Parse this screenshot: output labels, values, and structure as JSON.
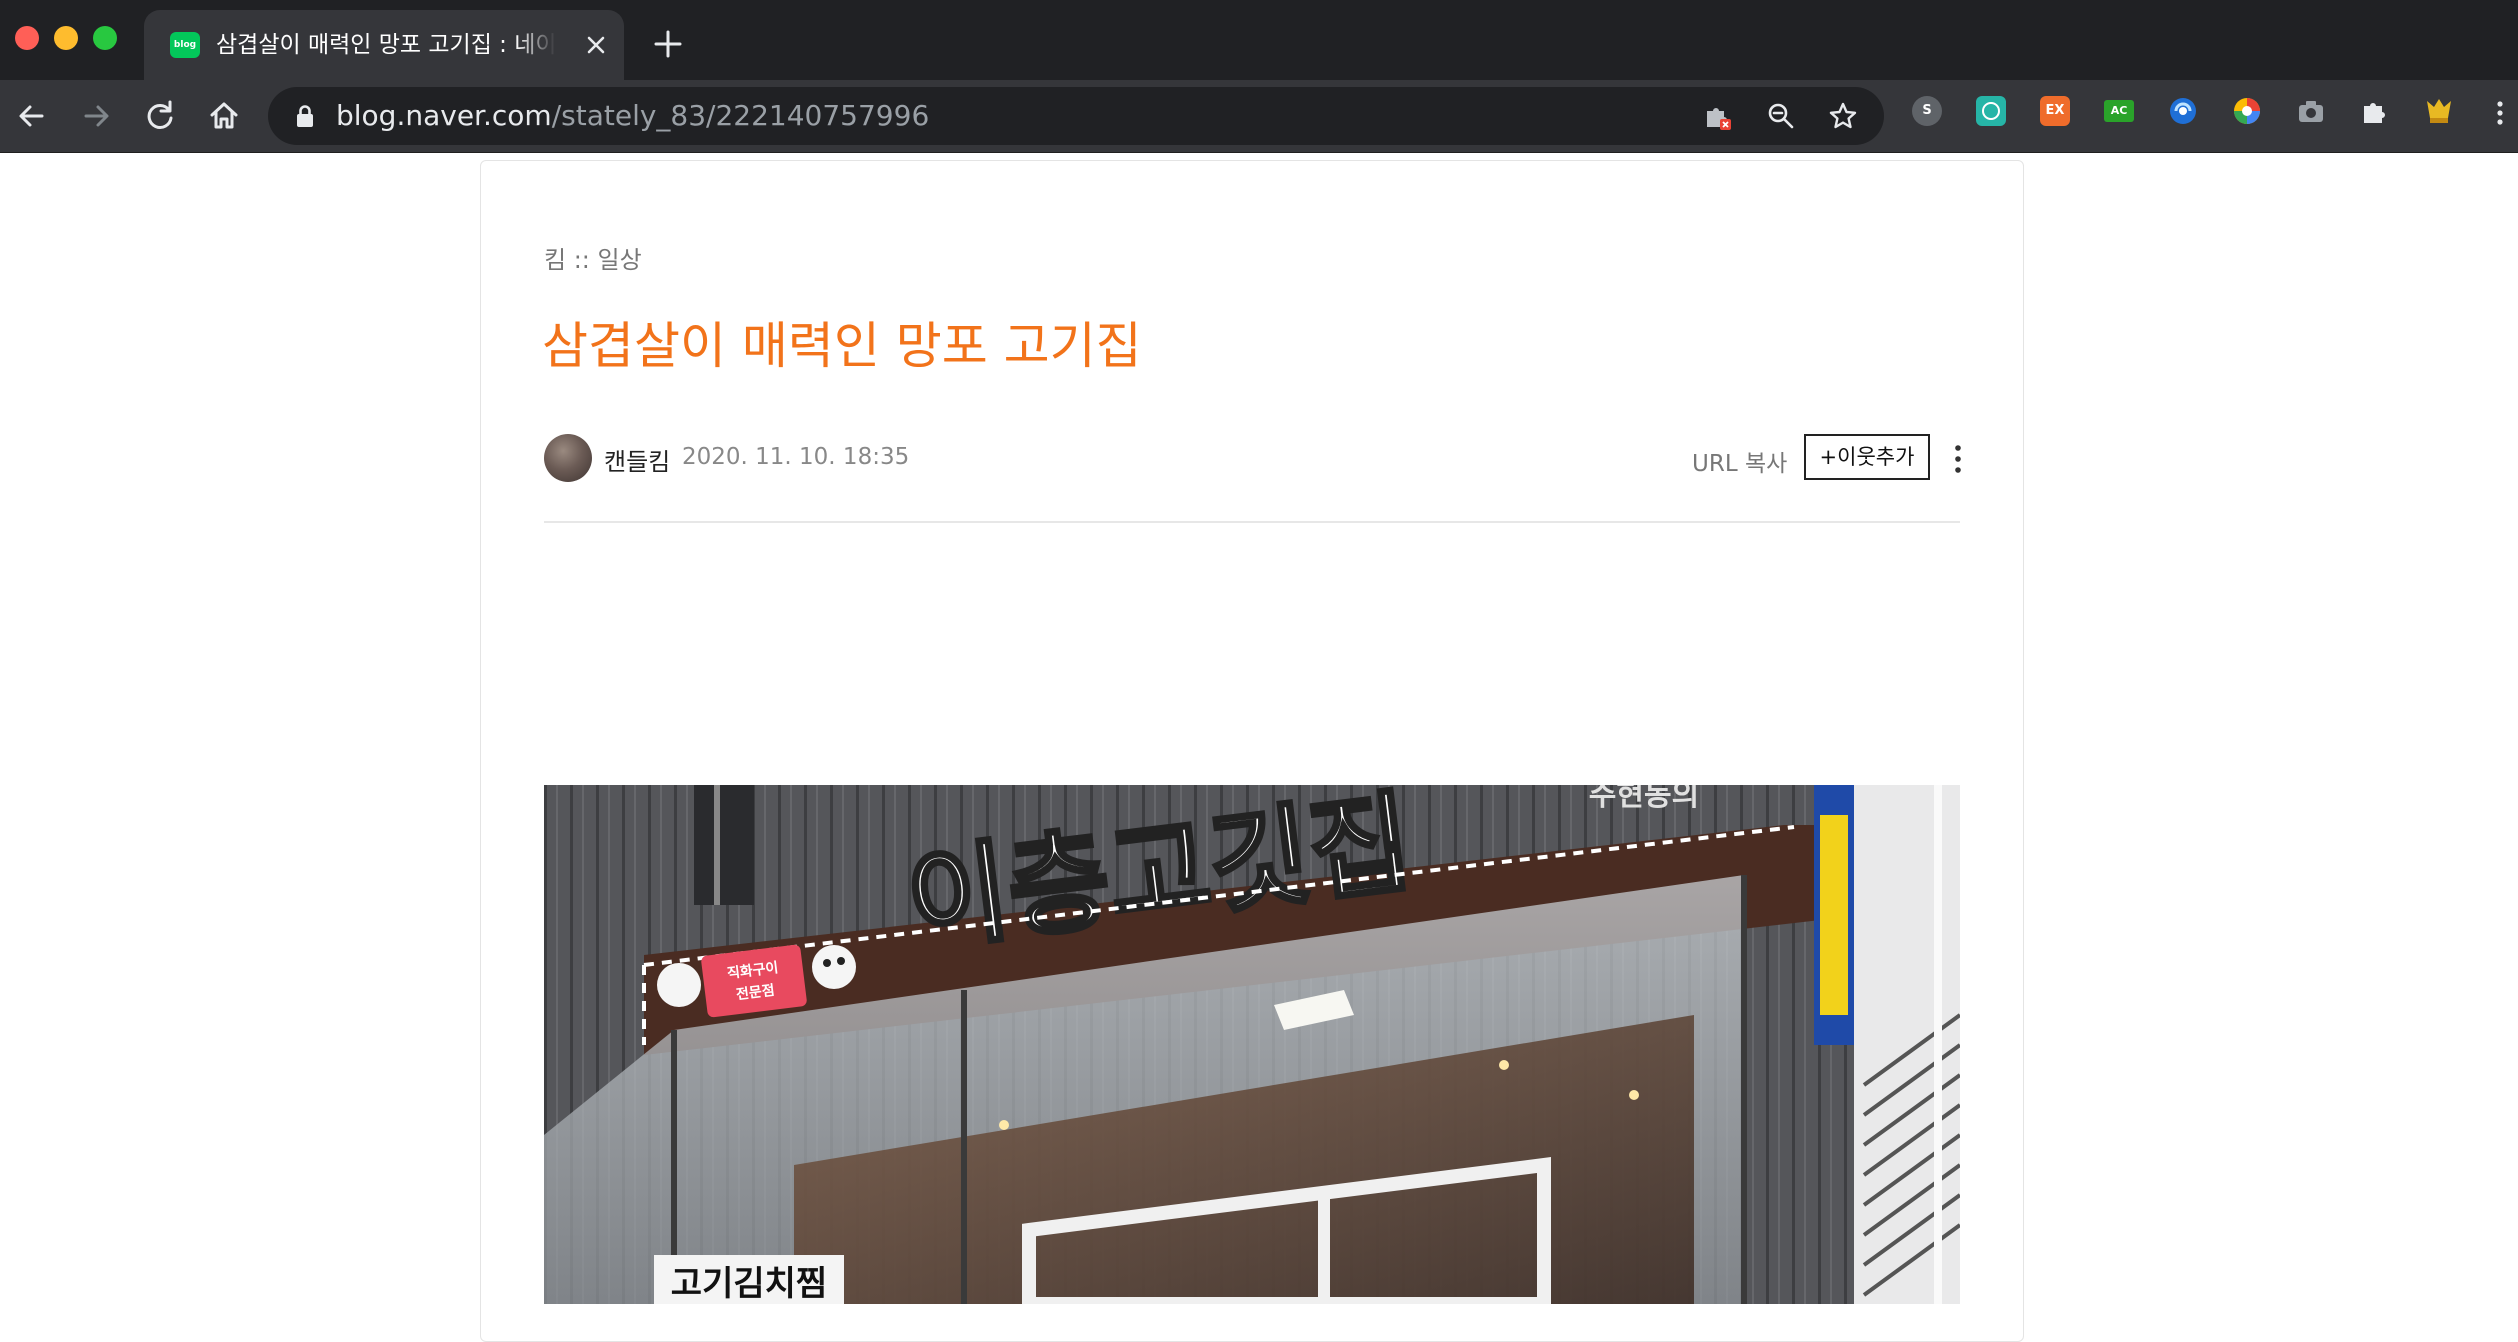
{
  "browser": {
    "tab_title": "삼겹살이 매력인 망포 고기집 : 네이버 블로그",
    "tab_favicon_text": "blog",
    "url_host": "blog.naver.com",
    "url_path": "/stately_83/222140757996",
    "extensions": [
      {
        "name": "skype",
        "label": "S",
        "color": "#5f6368"
      },
      {
        "name": "teal-ext",
        "label": "",
        "color": "#26b5a7"
      },
      {
        "name": "ex-ext",
        "label": "EX",
        "color": "#ef6c2b"
      },
      {
        "name": "ac-ext",
        "label": "AC",
        "color": "#2aa32a"
      }
    ]
  },
  "post": {
    "category": "킴 :: 일상",
    "title": "삼겹살이 매력인 망포 고기집",
    "author": "캔들킴",
    "date": "2020. 11. 10. 18:35",
    "url_copy_label": "URL 복사",
    "add_neighbor_label": "+이웃추가"
  },
  "photo": {
    "sign_text": "이층고깃집",
    "menu_sign_text": "고기김치찜",
    "badge_line1": "직화구이",
    "badge_line2": "전문점",
    "right_sign_text": "주현동의"
  }
}
